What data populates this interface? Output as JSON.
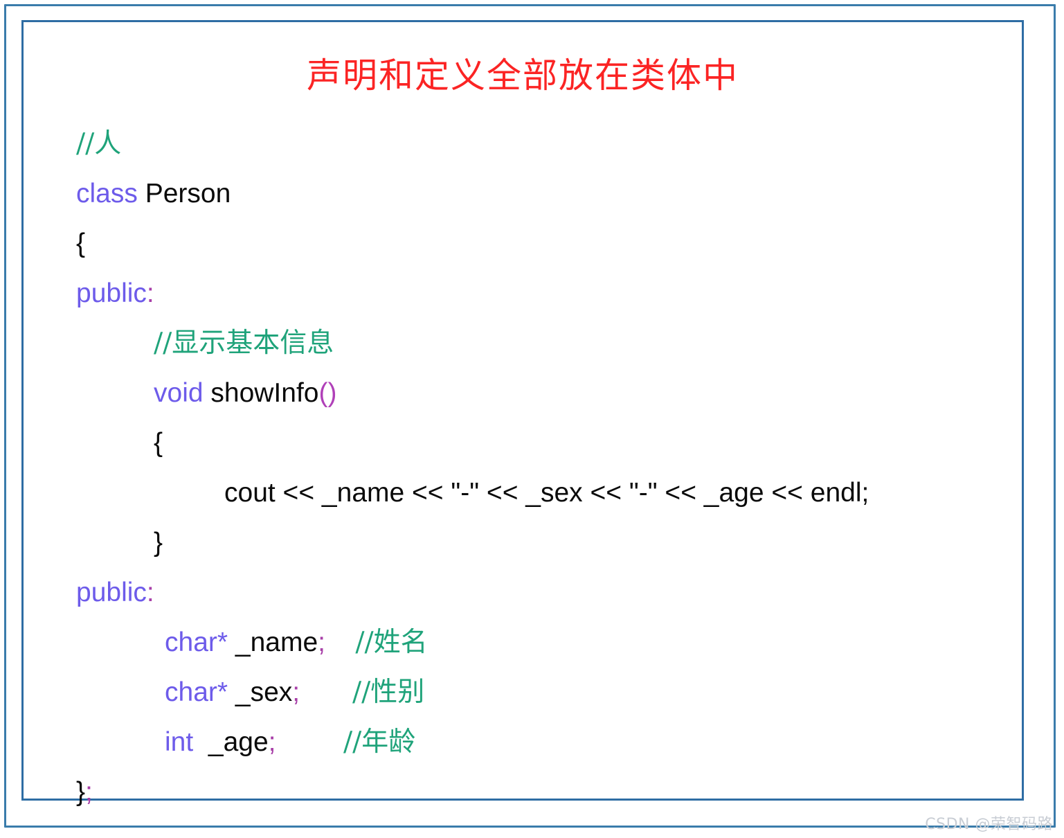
{
  "figure": {
    "title": "声明和定义全部放在类体中",
    "title_color": "#fb2424",
    "border_color": "#2e6da4",
    "outer_border_color": "#3a7cab",
    "background": "#ffffff"
  },
  "syntax_colors": {
    "keyword": "#6d5bea",
    "identifier": "#0a0a0a",
    "comment": "#1fa37a",
    "punctuation": "#a83fa8",
    "parenthesis": "#b040b8"
  },
  "code": {
    "language": "cpp",
    "lines": [
      {
        "indent": 0,
        "tokens": [
          {
            "text": "//人",
            "type": "comment-cn"
          }
        ]
      },
      {
        "indent": 0,
        "tokens": [
          {
            "text": "class",
            "type": "keyword"
          },
          {
            "text": " Person",
            "type": "plain"
          }
        ]
      },
      {
        "indent": 0,
        "tokens": [
          {
            "text": "{",
            "type": "plain"
          }
        ]
      },
      {
        "indent": 0,
        "tokens": [
          {
            "text": "public",
            "type": "keyword"
          },
          {
            "text": ":",
            "type": "punct"
          }
        ]
      },
      {
        "indent": 1,
        "tokens": [
          {
            "text": "//显示基本信息",
            "type": "comment-cn"
          }
        ]
      },
      {
        "indent": 1,
        "tokens": [
          {
            "text": "void",
            "type": "keyword"
          },
          {
            "text": " showInfo",
            "type": "plain"
          },
          {
            "text": "()",
            "type": "paren"
          }
        ]
      },
      {
        "indent": 1,
        "tokens": [
          {
            "text": "{",
            "type": "plain"
          }
        ]
      },
      {
        "indent": 2,
        "tokens": [
          {
            "text": "cout << _name << \"-\" << _sex << \"-\" << _age << endl;",
            "type": "plain"
          }
        ]
      },
      {
        "indent": 1,
        "tokens": [
          {
            "text": "}",
            "type": "plain"
          }
        ]
      },
      {
        "indent": 0,
        "tokens": [
          {
            "text": "public",
            "type": "keyword"
          },
          {
            "text": ":",
            "type": "punct"
          }
        ]
      },
      {
        "indent": 1,
        "tokens": [
          {
            "text": "char*",
            "type": "keyword"
          },
          {
            "text": " _name",
            "type": "plain"
          },
          {
            "text": ";",
            "type": "punct"
          },
          {
            "text": "    ",
            "type": "plain"
          },
          {
            "text": "//姓名",
            "type": "comment-cn"
          }
        ]
      },
      {
        "indent": 1,
        "tokens": [
          {
            "text": "char*",
            "type": "keyword"
          },
          {
            "text": " _sex",
            "type": "plain"
          },
          {
            "text": ";",
            "type": "punct"
          },
          {
            "text": "       ",
            "type": "plain"
          },
          {
            "text": "//性别",
            "type": "comment-cn"
          }
        ]
      },
      {
        "indent": 1,
        "tokens": [
          {
            "text": "int",
            "type": "keyword"
          },
          {
            "text": "  _age",
            "type": "plain"
          },
          {
            "text": ";",
            "type": "punct"
          },
          {
            "text": "         ",
            "type": "plain"
          },
          {
            "text": "//年龄",
            "type": "comment-cn"
          }
        ]
      },
      {
        "indent": 0,
        "tokens": [
          {
            "text": "}",
            "type": "plain"
          },
          {
            "text": ";",
            "type": "punct"
          }
        ]
      }
    ]
  },
  "watermark": {
    "text": "CSDN @荣智码路"
  }
}
